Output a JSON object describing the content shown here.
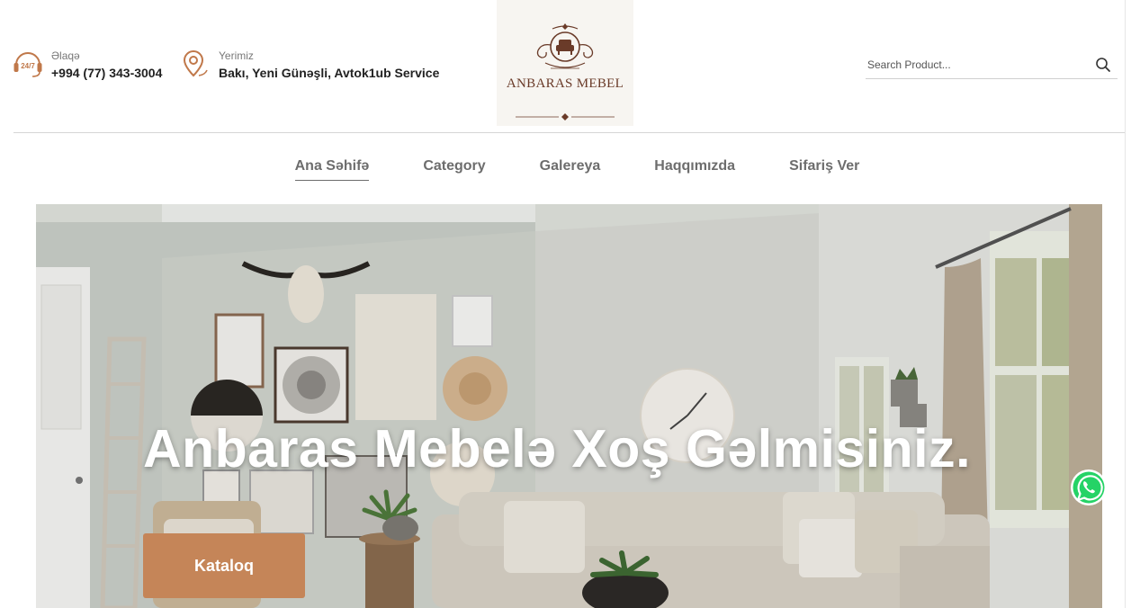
{
  "header": {
    "contact": {
      "label": "Əlaqə",
      "value": "+994 (77) 343-3004",
      "icon": "headset-24-7-icon"
    },
    "address": {
      "label": "Yerimiz",
      "value": "Bakı, Yeni Günəşli, Avtok1ub Service",
      "icon": "location-pin-icon"
    },
    "logo": {
      "text": "ANBARAS MEBEL",
      "icon": "armchair-crest-icon"
    },
    "search": {
      "placeholder": "Search Product...",
      "icon": "search-icon"
    }
  },
  "nav": {
    "items": [
      {
        "label": "Ana Səhifə",
        "active": true
      },
      {
        "label": "Category",
        "active": false
      },
      {
        "label": "Galereya",
        "active": false
      },
      {
        "label": "Haqqımızda",
        "active": false
      },
      {
        "label": "Sifariş Ver",
        "active": false
      }
    ]
  },
  "hero": {
    "title": "Anbaras Mebelə Xoş Gəlmisiniz.",
    "button_label": "Kataloq"
  },
  "floating": {
    "whatsapp_icon": "whatsapp-icon"
  },
  "colors": {
    "accent": "#c58558",
    "brand": "#6a3b29",
    "whatsapp": "#25d366",
    "nav_text": "#6d6d6d"
  }
}
